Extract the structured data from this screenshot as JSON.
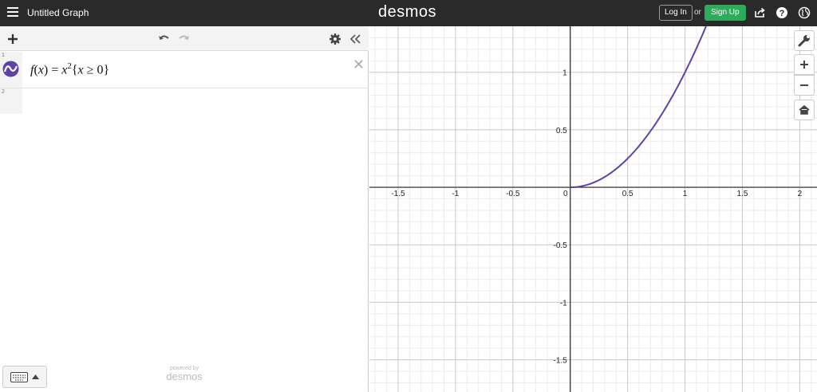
{
  "header": {
    "title": "Untitled Graph",
    "logo": "desmos",
    "login": "Log In",
    "or": "or",
    "signup": "Sign Up",
    "icons": [
      "menu-icon",
      "share-icon",
      "help-icon",
      "language-globe-icon"
    ]
  },
  "expressions": {
    "rows": [
      {
        "number": "1",
        "color": "#6042a6",
        "latex": "f(x)=x^2\\{x\\ge 0\\}",
        "display": {
          "f": "f",
          "lparen": "(",
          "var": "x",
          "rparen": ")",
          "eq": "=",
          "base": "x",
          "exp": "2",
          "brace_open": "{",
          "cond_var": "x",
          "ge": "≥",
          "cond_val": "0",
          "brace_close": "}"
        }
      },
      {
        "number": "2"
      }
    ],
    "toolbar_icons": [
      "add-icon",
      "undo-icon",
      "redo-icon",
      "settings-gear-icon",
      "collapse-icon"
    ],
    "powered_by": "powered by",
    "powered_brand": "desmos"
  },
  "graph": {
    "x_range": [
      -1.75,
      2.15
    ],
    "y_range": [
      -1.78,
      1.4
    ],
    "x_ticks": [
      "-1.5",
      "-1",
      "-0.5",
      "0",
      "0.5",
      "1",
      "1.5",
      "2"
    ],
    "y_ticks": [
      "1",
      "0.5",
      "-0.5",
      "-1",
      "-1.5"
    ],
    "curve_color": "#6042a6",
    "side_buttons": [
      "wrench-icon",
      "zoom-in-icon",
      "zoom-out-icon",
      "home-icon"
    ]
  }
}
